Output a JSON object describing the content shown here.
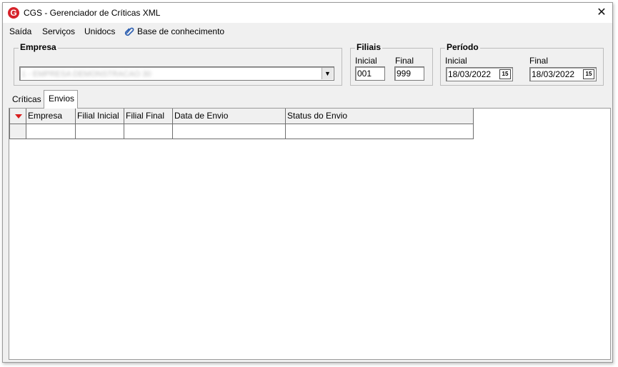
{
  "window": {
    "title": "CGS - Gerenciador de Críticas XML",
    "icon_letter": "G",
    "close_glyph": "✕"
  },
  "menu": {
    "items": [
      "Saída",
      "Serviços",
      "Unidocs"
    ],
    "kb_label": "Base de conhecimento",
    "kb_icon": "clip-icon"
  },
  "empresa": {
    "group_title": "Empresa",
    "selected_value": "1 - EMPRESA DEMONSTRACAO 30"
  },
  "filiais": {
    "group_title": "Filiais",
    "inicial_label": "Inicial",
    "final_label": "Final",
    "inicial_value": "001",
    "final_value": "999"
  },
  "periodo": {
    "group_title": "Período",
    "inicial_label": "Inicial",
    "final_label": "Final",
    "inicial_value": "18/03/2022",
    "final_value": "18/03/2022",
    "calendar_glyph": "15"
  },
  "tabs": [
    {
      "label": "Críticas",
      "active": false
    },
    {
      "label": "Envios",
      "active": true
    }
  ],
  "grid": {
    "columns": [
      "Empresa",
      "Filial Inicial",
      "Filial Final",
      "Data de Envio",
      "Status do Envio"
    ]
  },
  "colors": {
    "accent_red": "#d81e1e",
    "window_bg": "#f0f0f0"
  }
}
